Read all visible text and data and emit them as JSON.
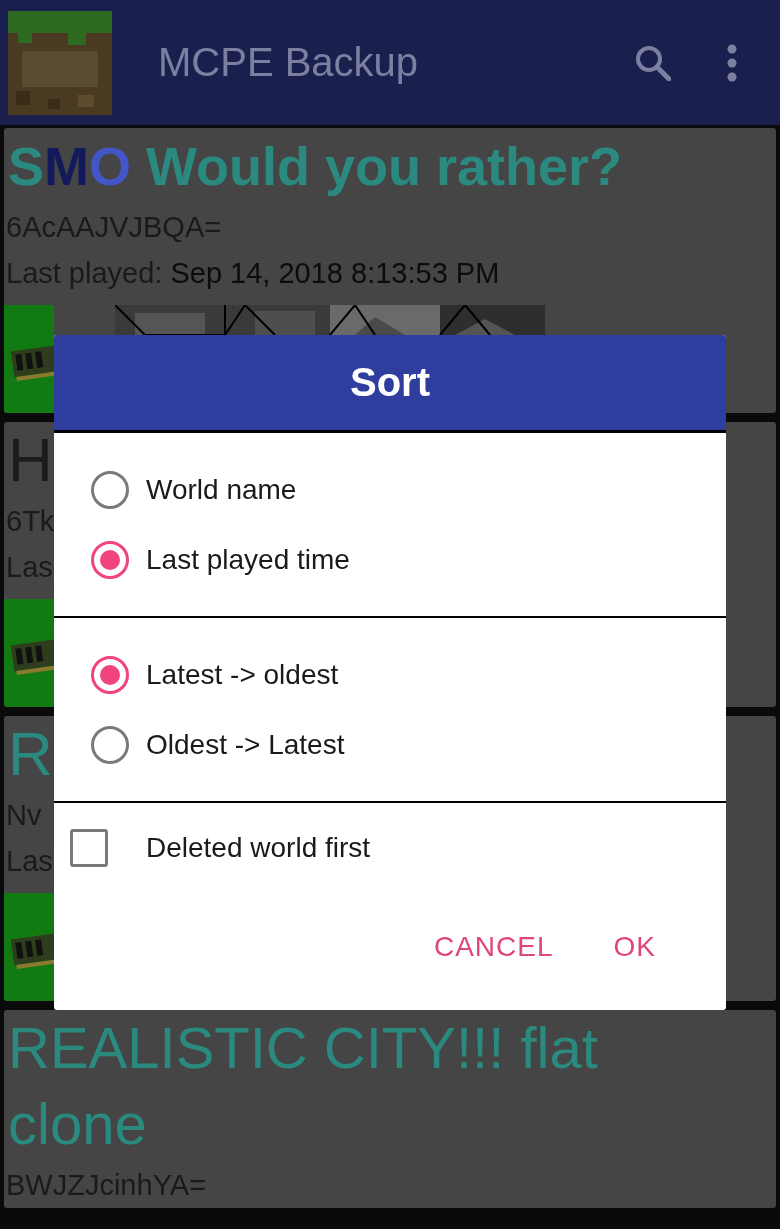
{
  "app_bar": {
    "title": "MCPE Backup"
  },
  "worlds": [
    {
      "title": [
        {
          "text": "S",
          "color": "#2a8a7f"
        },
        {
          "text": "M",
          "color": "#131a5c"
        },
        {
          "text": "O ",
          "color": "#4356c8"
        },
        {
          "text": "Would you rather?",
          "color": "#2a8a7f"
        }
      ],
      "id": "6AcAAJVJBQA=",
      "last_played_label": "Last played:",
      "last_played_value": "Sep 14, 2018 8:13:53 PM"
    },
    {
      "title": [
        {
          "text": "H",
          "color": "#1c1c1c"
        }
      ],
      "id": "6Tk",
      "last_played_label": "Las"
    },
    {
      "title": [
        {
          "text": "R",
          "color": "#2a8a7f"
        }
      ],
      "id": "Nv",
      "last_played_label": "Las"
    },
    {
      "title": [
        {
          "text": "REALISTIC CITY!!! flat clone",
          "color": "#2a8a7f"
        }
      ],
      "id": "BWJZJcinhYA="
    }
  ],
  "dialog": {
    "title": "Sort",
    "groups": [
      {
        "options": [
          {
            "label": "World name",
            "selected": false
          },
          {
            "label": "Last played time",
            "selected": true
          }
        ]
      },
      {
        "options": [
          {
            "label": "Latest -> oldest",
            "selected": true
          },
          {
            "label": "Oldest -> Latest",
            "selected": false
          }
        ]
      }
    ],
    "checkbox": {
      "label": "Deleted world first",
      "checked": false
    },
    "buttons": [
      "CANCEL",
      "OK"
    ]
  }
}
